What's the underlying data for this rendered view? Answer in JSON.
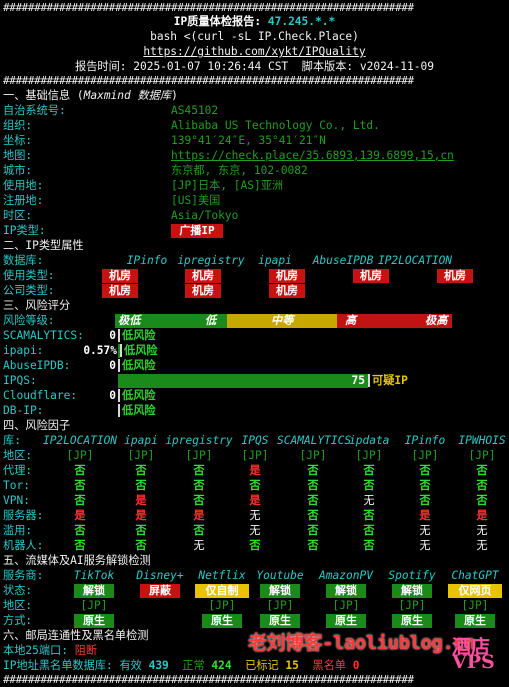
{
  "hash_line": "##################################################################",
  "header": {
    "title_prefix": "IP质量体检报告: ",
    "ip": "47.245.*.*",
    "cmd": "bash <(curl -sL IP.Check.Place)",
    "url": "https://github.com/xykt/IPQuality",
    "report_time_label": "报告时间: ",
    "report_time": "2025-01-07 10:26:44 CST",
    "version_label": "  脚本版本: ",
    "version": "v2024-11-09"
  },
  "basic": {
    "title": "一、基础信息 (",
    "title_italic": "Maxmind 数据库",
    "title_end": ")",
    "rows": [
      {
        "label": "自治系统号:",
        "value": "AS45102"
      },
      {
        "label": "组织:",
        "value": "Alibaba US Technology Co., Ltd."
      },
      {
        "label": "坐标:",
        "value": "139°41′24″E, 35°41′21″N"
      },
      {
        "label": "地图:",
        "value": "https://check.place/35.6893,139.6899,15,cn"
      },
      {
        "label": "城市:",
        "value": "东京都, 东京, 102-0082"
      },
      {
        "label": "使用地:",
        "value": "[JP]日本, [AS]亚洲"
      },
      {
        "label": "注册地:",
        "value": "[US]美国"
      },
      {
        "label": "时区:",
        "value": "Asia/Tokyo"
      },
      {
        "label": "IP类型:",
        "value": "广播IP"
      }
    ]
  },
  "iptype": {
    "title": "二、IP类型属性",
    "db_label": "数据库:",
    "dbs": [
      "IPinfo",
      "ipregistry",
      "ipapi",
      "AbuseIPDB",
      "IP2LOCATION"
    ],
    "use_label": "使用类型:",
    "use_vals": [
      "机房",
      "机房",
      "机房",
      "机房",
      "机房"
    ],
    "company_label": "公司类型:",
    "company_vals": [
      "机房",
      "机房",
      "机房"
    ]
  },
  "risk": {
    "title": "三、风险评分",
    "level_label": "风险等级:",
    "levels": [
      "极低",
      "低",
      "中等",
      "高",
      "极高"
    ],
    "rows": [
      {
        "label": "SCAMALYTICS:",
        "score": "0",
        "text": "低风险",
        "fill": 0
      },
      {
        "label": "ipapi:",
        "score": "0.57%",
        "text": "低风险",
        "fill": 0.0057
      },
      {
        "label": "AbuseIPDB:",
        "score": "0",
        "text": "低风险",
        "fill": 0
      },
      {
        "label": "IPQS:",
        "score": "75",
        "text": "可疑IP",
        "fill": 0.75
      },
      {
        "label": "Cloudflare:",
        "score": "0",
        "text": "低风险",
        "fill": 0
      },
      {
        "label": "DB-IP:",
        "score": "",
        "text": "低风险",
        "fill": 0
      }
    ]
  },
  "factors": {
    "title": "四、风险因子",
    "lib_label": "库:",
    "libs": [
      "IP2LOCATION",
      "ipapi",
      "ipregistry",
      "IPQS",
      "SCAMALYTICS",
      "ipdata",
      "IPinfo",
      "IPWHOIS"
    ],
    "rows": [
      {
        "label": "地区:",
        "vals": [
          "[JP]",
          "[JP]",
          "[JP]",
          "[JP]",
          "[JP]",
          "[JP]",
          "[JP]",
          "[JP]"
        ]
      },
      {
        "label": "代理:",
        "vals": [
          "否",
          "否",
          "否",
          "是",
          "否",
          "否",
          "否",
          "否"
        ]
      },
      {
        "label": "Tor:",
        "vals": [
          "否",
          "否",
          "否",
          "否",
          "否",
          "否",
          "否",
          "否"
        ]
      },
      {
        "label": "VPN:",
        "vals": [
          "否",
          "是",
          "否",
          "是",
          "否",
          "无",
          "否",
          "否"
        ]
      },
      {
        "label": "服务器:",
        "vals": [
          "是",
          "是",
          "是",
          "无",
          "否",
          "否",
          "是",
          "是"
        ]
      },
      {
        "label": "滥用:",
        "vals": [
          "否",
          "否",
          "否",
          "无",
          "否",
          "否",
          "无",
          "无"
        ]
      },
      {
        "label": "机器人:",
        "vals": [
          "否",
          "否",
          "无",
          "否",
          "否",
          "否",
          "无",
          "无"
        ]
      }
    ]
  },
  "media": {
    "title": "五、流媒体及AI服务解锁检测",
    "service_label": "服务商:",
    "services": [
      "TikTok",
      "Disney+",
      "Netflix",
      "Youtube",
      "AmazonPV",
      "Spotify",
      "ChatGPT"
    ],
    "status_label": "状态:",
    "statuses": [
      "解锁",
      "屏蔽",
      "仅自制",
      "解锁",
      "解锁",
      "解锁",
      "仅网页"
    ],
    "region_label": "地区:",
    "regions": [
      "[JP]",
      "",
      "[JP]",
      "[JP]",
      "[JP]",
      "[JP]",
      "[JP]"
    ],
    "method_label": "方式:",
    "methods": [
      "原生",
      "",
      "原生",
      "原生",
      "原生",
      "原生",
      "原生"
    ]
  },
  "mail": {
    "title": "六、邮局连通性及黑名单检测",
    "port_label": "本地25端口: ",
    "port_value": "阻断",
    "bl_label": "IP地址黑名单数据库: ",
    "valid_label": "有效 ",
    "valid": "439",
    "normal_label": "正常 ",
    "normal": "424",
    "marked_label": "已标记 ",
    "marked": "15",
    "black_label": "黑名单 ",
    "black": "0"
  },
  "watermark": {
    "text1": "老刘博客-laoliublog.cn",
    "text2": "酒店VPS"
  },
  "colors": {
    "green": "#2dd22d",
    "red": "#ff3030",
    "cyan": "#2bc8c8",
    "yellow": "#e6c600"
  }
}
